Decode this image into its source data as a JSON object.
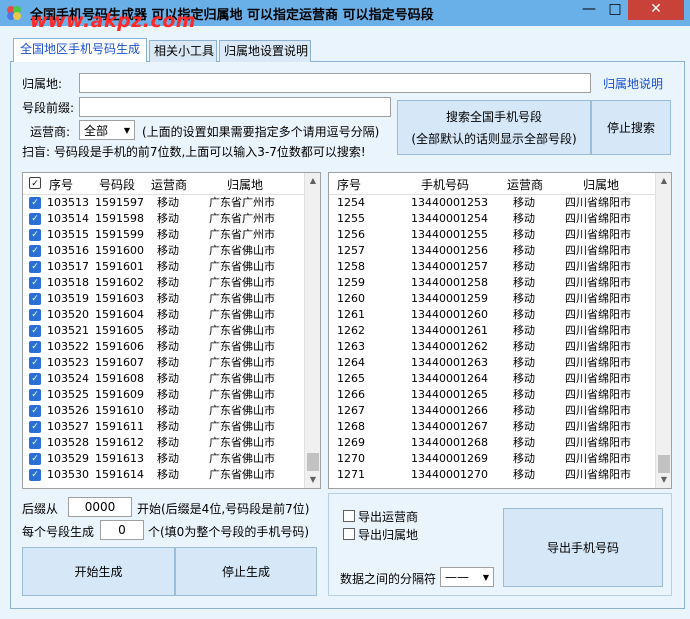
{
  "window": {
    "title": "全国手机号码生成器   可以指定归属地   可以指定运营商   可以指定号码段",
    "watermark": "www.akpz.com",
    "minimize": "—",
    "maximize": "□",
    "close": "✕"
  },
  "tabs": [
    "全国地区手机号码生成",
    "相关小工具",
    "归属地设置说明"
  ],
  "form": {
    "region_label": "归属地:",
    "region_value": "",
    "region_help_link": "归属地说明",
    "prefix_label": "号段前缀:",
    "prefix_value": "",
    "carrier_label": "运营商:",
    "carrier_value": "全部",
    "note": "(上面的设置如果需要指定多个请用逗号分隔)",
    "tip": "扫盲: 号码段是手机的前7位数,上面可以输入3-7位数都可以搜索!",
    "search_button_line1": "搜索全国手机号段",
    "search_button_line2": "(全部默认的话则显示全部号段)",
    "stop_search_button": "停止搜索"
  },
  "left_table": {
    "columns": [
      "序号",
      "号码段",
      "运营商",
      "归属地"
    ],
    "rows": [
      [
        "103513",
        "1591597",
        "移动",
        "广东省广州市"
      ],
      [
        "103514",
        "1591598",
        "移动",
        "广东省广州市"
      ],
      [
        "103515",
        "1591599",
        "移动",
        "广东省广州市"
      ],
      [
        "103516",
        "1591600",
        "移动",
        "广东省佛山市"
      ],
      [
        "103517",
        "1591601",
        "移动",
        "广东省佛山市"
      ],
      [
        "103518",
        "1591602",
        "移动",
        "广东省佛山市"
      ],
      [
        "103519",
        "1591603",
        "移动",
        "广东省佛山市"
      ],
      [
        "103520",
        "1591604",
        "移动",
        "广东省佛山市"
      ],
      [
        "103521",
        "1591605",
        "移动",
        "广东省佛山市"
      ],
      [
        "103522",
        "1591606",
        "移动",
        "广东省佛山市"
      ],
      [
        "103523",
        "1591607",
        "移动",
        "广东省佛山市"
      ],
      [
        "103524",
        "1591608",
        "移动",
        "广东省佛山市"
      ],
      [
        "103525",
        "1591609",
        "移动",
        "广东省佛山市"
      ],
      [
        "103526",
        "1591610",
        "移动",
        "广东省佛山市"
      ],
      [
        "103527",
        "1591611",
        "移动",
        "广东省佛山市"
      ],
      [
        "103528",
        "1591612",
        "移动",
        "广东省佛山市"
      ],
      [
        "103529",
        "1591613",
        "移动",
        "广东省佛山市"
      ],
      [
        "103530",
        "1591614",
        "移动",
        "广东省佛山市"
      ]
    ]
  },
  "right_table": {
    "columns": [
      "序号",
      "手机号码",
      "运营商",
      "归属地"
    ],
    "rows": [
      [
        "1254",
        "13440001253",
        "移动",
        "四川省绵阳市"
      ],
      [
        "1255",
        "13440001254",
        "移动",
        "四川省绵阳市"
      ],
      [
        "1256",
        "13440001255",
        "移动",
        "四川省绵阳市"
      ],
      [
        "1257",
        "13440001256",
        "移动",
        "四川省绵阳市"
      ],
      [
        "1258",
        "13440001257",
        "移动",
        "四川省绵阳市"
      ],
      [
        "1259",
        "13440001258",
        "移动",
        "四川省绵阳市"
      ],
      [
        "1260",
        "13440001259",
        "移动",
        "四川省绵阳市"
      ],
      [
        "1261",
        "13440001260",
        "移动",
        "四川省绵阳市"
      ],
      [
        "1262",
        "13440001261",
        "移动",
        "四川省绵阳市"
      ],
      [
        "1263",
        "13440001262",
        "移动",
        "四川省绵阳市"
      ],
      [
        "1264",
        "13440001263",
        "移动",
        "四川省绵阳市"
      ],
      [
        "1265",
        "13440001264",
        "移动",
        "四川省绵阳市"
      ],
      [
        "1266",
        "13440001265",
        "移动",
        "四川省绵阳市"
      ],
      [
        "1267",
        "13440001266",
        "移动",
        "四川省绵阳市"
      ],
      [
        "1268",
        "13440001267",
        "移动",
        "四川省绵阳市"
      ],
      [
        "1269",
        "13440001268",
        "移动",
        "四川省绵阳市"
      ],
      [
        "1270",
        "13440001269",
        "移动",
        "四川省绵阳市"
      ],
      [
        "1271",
        "13440001270",
        "移动",
        "四川省绵阳市"
      ]
    ]
  },
  "generate": {
    "suffix_from_label": "后缀从",
    "suffix_from_value": "0000",
    "suffix_note": "开始(后缀是4位,号码段是前7位)",
    "per_segment_label": "每个号段生成",
    "per_segment_value": "0",
    "per_segment_note": "个(填0为整个号段的手机号码)",
    "start_button": "开始生成",
    "stop_button": "停止生成"
  },
  "export": {
    "export_carrier": "导出运营商",
    "export_region": "导出归属地",
    "separator_label": "数据之间的分隔符",
    "separator_value": "——",
    "export_button": "导出手机号码"
  },
  "colors": {
    "titlebar": "#6ab0e8",
    "close_button": "#c8423a",
    "accent_blue": "#1a4fd0",
    "checkbox_blue": "#2a6fd6",
    "watermark_red": "#ff2a2a"
  }
}
